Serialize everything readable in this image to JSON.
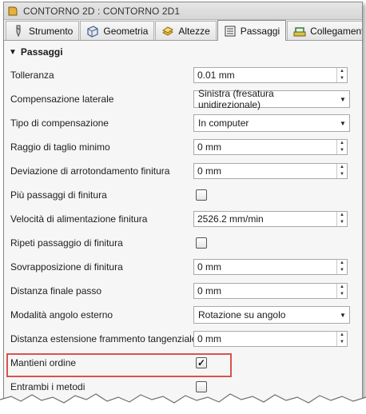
{
  "window": {
    "title": "CONTORNO 2D : CONTORNO 2D1"
  },
  "tabs": [
    {
      "label": "Strumento",
      "icon": "tool-icon"
    },
    {
      "label": "Geometria",
      "icon": "geometry-icon"
    },
    {
      "label": "Altezze",
      "icon": "heights-icon"
    },
    {
      "label": "Passaggi",
      "icon": "passes-icon",
      "active": true
    },
    {
      "label": "Collegamento",
      "icon": "linking-icon"
    }
  ],
  "section": {
    "title": "Passaggi",
    "caret": "▼"
  },
  "rows": [
    {
      "label": "Tolleranza",
      "type": "number",
      "value": "0.01 mm"
    },
    {
      "label": "Compensazione laterale",
      "type": "select",
      "value": "Sinistra (fresatura unidirezionale)"
    },
    {
      "label": "Tipo di compensazione",
      "type": "select",
      "value": "In computer"
    },
    {
      "label": "Raggio di taglio minimo",
      "type": "number",
      "value": "0 mm"
    },
    {
      "label": "Deviazione di arrotondamento finitura",
      "type": "number",
      "value": "0 mm"
    },
    {
      "label": "Più passaggi di finitura",
      "type": "checkbox",
      "checked": false
    },
    {
      "label": "Velocità di alimentazione finitura",
      "type": "number",
      "value": "2526.2 mm/min"
    },
    {
      "label": "Ripeti passaggio di finitura",
      "type": "checkbox",
      "checked": false
    },
    {
      "label": "Sovrapposizione di finitura",
      "type": "number",
      "value": "0 mm"
    },
    {
      "label": "Distanza finale passo",
      "type": "number",
      "value": "0 mm"
    },
    {
      "label": "Modalità angolo esterno",
      "type": "select",
      "value": "Rotazione su angolo"
    },
    {
      "label": "Distanza estensione frammento tangenziale",
      "type": "number",
      "value": "0 mm"
    },
    {
      "label": "Mantieni ordine",
      "type": "checkbox",
      "checked": true
    },
    {
      "label": "Entrambi i metodi",
      "type": "checkbox",
      "checked": false
    }
  ],
  "glyphs": {
    "check": "✓",
    "up": "▲",
    "down": "▼",
    "dropdown": "▼"
  },
  "colors": {
    "highlight": "#d9534f"
  }
}
